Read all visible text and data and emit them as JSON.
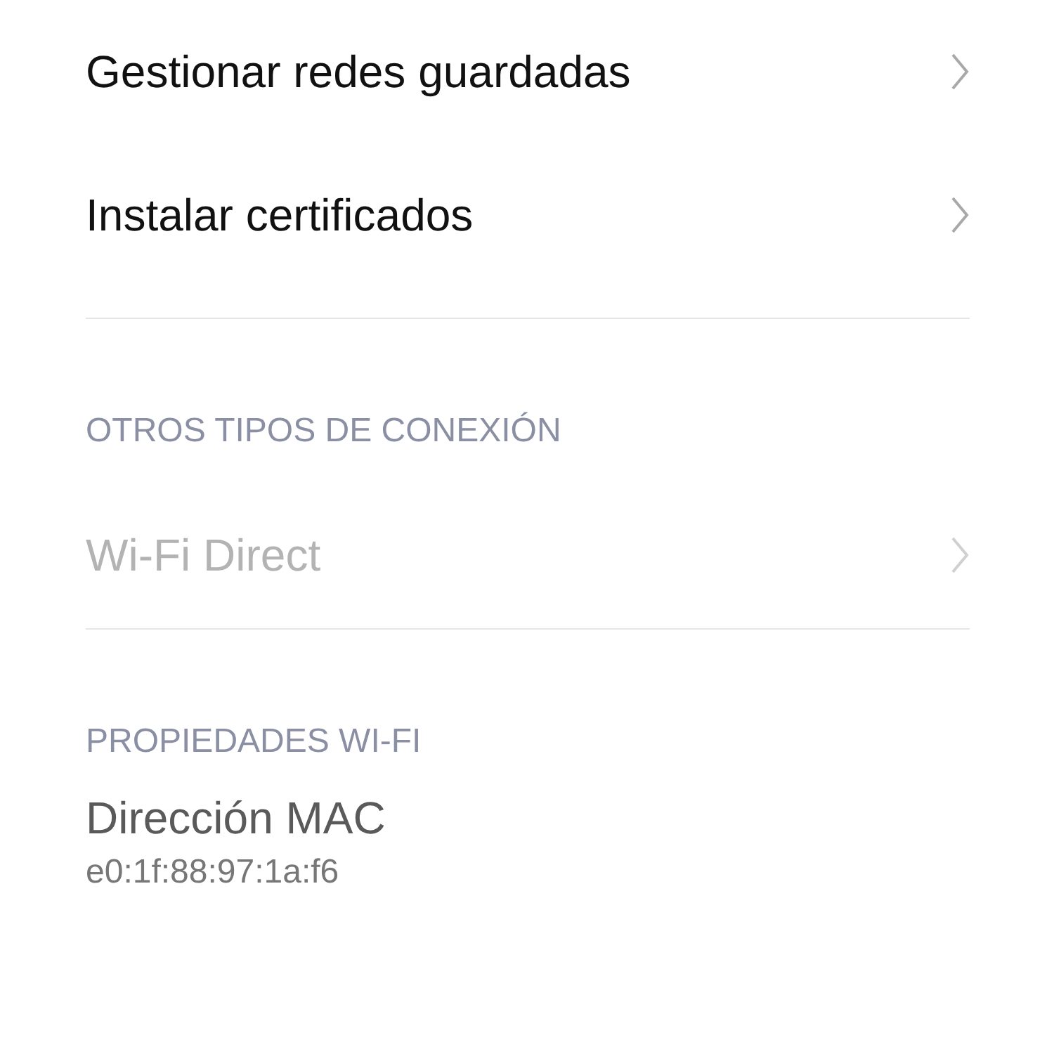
{
  "sections": [
    {
      "items": [
        {
          "kind": "link",
          "title": "Gestionar redes guardadas",
          "disabled": false
        },
        {
          "kind": "link",
          "title": "Instalar certificados",
          "disabled": false
        }
      ]
    },
    {
      "header": "OTROS TIPOS DE CONEXIÓN",
      "items": [
        {
          "kind": "link",
          "title": "Wi-Fi Direct",
          "disabled": true
        }
      ]
    },
    {
      "header": "PROPIEDADES WI-FI",
      "items": [
        {
          "kind": "info",
          "title": "Dirección MAC",
          "value": "e0:1f:88:97:1a:f6"
        }
      ]
    }
  ]
}
